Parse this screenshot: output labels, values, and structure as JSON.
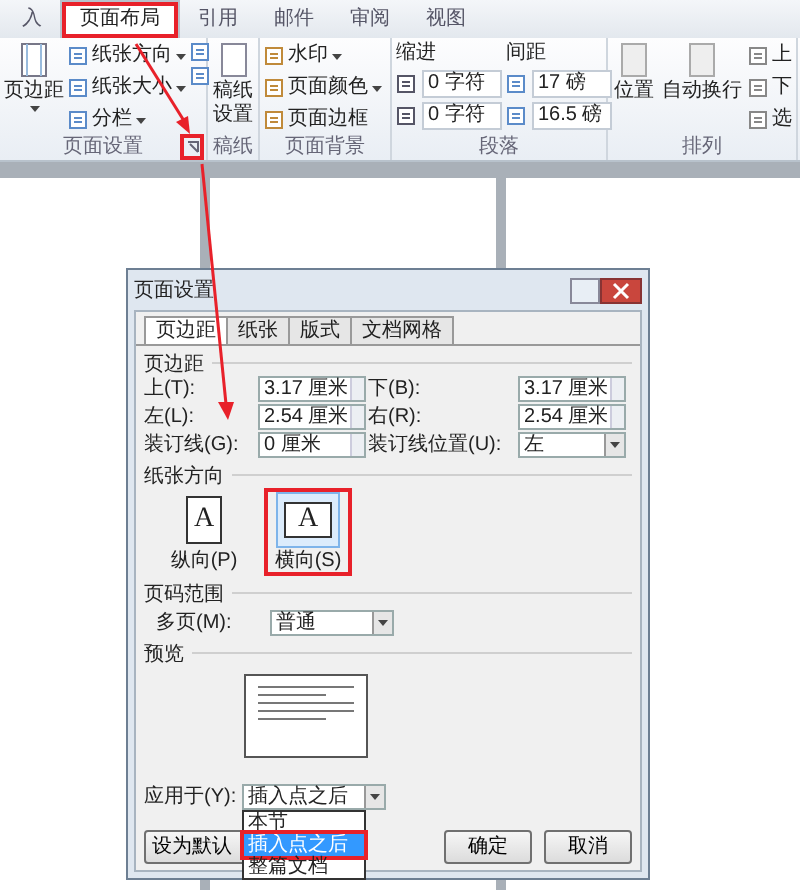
{
  "ribbon": {
    "tabs": [
      {
        "label": "入",
        "selected": false
      },
      {
        "label": "页面布局",
        "selected": true
      },
      {
        "label": "引用",
        "selected": false
      },
      {
        "label": "邮件",
        "selected": false
      },
      {
        "label": "审阅",
        "selected": false
      },
      {
        "label": "视图",
        "selected": false
      }
    ],
    "page_setup": {
      "margins_button": "页边距",
      "menus": [
        "纸张方向",
        "纸张大小",
        "分栏"
      ],
      "label": "页面设置"
    },
    "draft": {
      "button": "稿纸设置",
      "label": "稿纸"
    },
    "background": {
      "items": [
        "水印",
        "页面颜色",
        "页面边框"
      ],
      "label": "页面背景"
    },
    "paragraph": {
      "indent_label": "缩进",
      "spacing_label": "间距",
      "indent": [
        "0 字符",
        "0 字符"
      ],
      "spacing": [
        "17 磅",
        "16.5 磅"
      ],
      "label": "段落"
    },
    "arrange": {
      "buttons": [
        "位置",
        "自动换行"
      ],
      "small": [
        "上",
        "下",
        "选"
      ],
      "label": "排列"
    }
  },
  "dialog": {
    "title": "页面设置",
    "tabs": [
      {
        "label": "页边距",
        "selected": true
      },
      {
        "label": "纸张",
        "selected": false
      },
      {
        "label": "版式",
        "selected": false
      },
      {
        "label": "文档网格",
        "selected": false
      }
    ],
    "margins": {
      "heading": "页边距",
      "fields": [
        {
          "label": "上(T):",
          "value": "3.17 厘米"
        },
        {
          "label": "下(B):",
          "value": "3.17 厘米"
        },
        {
          "label": "左(L):",
          "value": "2.54 厘米"
        },
        {
          "label": "右(R):",
          "value": "2.54 厘米"
        },
        {
          "label": "装订线(G):",
          "value": "0 厘米"
        }
      ],
      "gutter_position": {
        "label": "装订线位置(U):",
        "value": "左"
      }
    },
    "orientation": {
      "heading": "纸张方向",
      "options": [
        {
          "label": "纵向(P)",
          "glyph": "A",
          "selected": false
        },
        {
          "label": "横向(S)",
          "glyph": "A",
          "selected": true
        }
      ]
    },
    "pages": {
      "heading": "页码范围",
      "label": "多页(M):",
      "value": "普通"
    },
    "preview": {
      "heading": "预览"
    },
    "apply": {
      "label": "应用于(Y):",
      "value": "插入点之后",
      "options": [
        {
          "label": "本节",
          "selected": false
        },
        {
          "label": "插入点之后",
          "selected": true
        },
        {
          "label": "整篇文档",
          "selected": false
        }
      ]
    },
    "buttons": [
      "设为默认",
      "确定",
      "取消"
    ]
  }
}
